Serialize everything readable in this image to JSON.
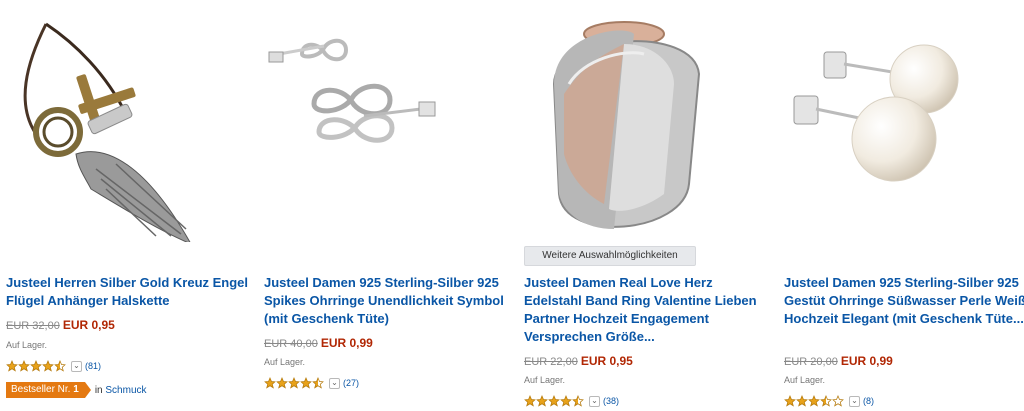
{
  "products": [
    {
      "title": "Justeel Herren Silber Gold Kreuz Engel Flügel Anhänger Halskette",
      "old_price": "EUR 32,00",
      "new_price": "EUR 0,95",
      "stock": "Auf Lager.",
      "rating_count": "(81)",
      "stars": 4.5,
      "image_icon": "angel-wing-necklace-image"
    },
    {
      "title": "Justeel Damen 925 Sterling-Silber 925 Spikes Ohrringe Unendlichkeit Symbol (mit Geschenk Tüte)",
      "old_price": "EUR 40,00",
      "new_price": "EUR 0,99",
      "stock": "Auf Lager.",
      "rating_count": "(27)",
      "stars": 4.5,
      "image_icon": "infinity-earrings-image"
    },
    {
      "title": "Justeel Damen Real Love Herz Edelstahl Band Ring Valentine Lieben Partner Hochzeit Engagement Versprechen Größe...",
      "old_price": "EUR 22,00",
      "new_price": "EUR 0,95",
      "stock": "Auf Lager.",
      "rating_count": "(38)",
      "stars": 4.5,
      "variants_label": "Weitere Auswahlmöglichkeiten",
      "image_icon": "heart-ring-image"
    },
    {
      "title": "Justeel Damen 925 Sterling-Silber 925 Gestüt Ohrringe Süßwasser Perle Weiß Hochzeit Elegant (mit Geschenk Tüte...",
      "old_price": "EUR 20,00",
      "new_price": "EUR 0,99",
      "stock": "Auf Lager.",
      "rating_count": "(8)",
      "stars": 3.5,
      "image_icon": "pearl-earrings-image"
    }
  ],
  "bestseller": {
    "label": "Bestseller Nr.",
    "rank": "1",
    "prefix": "in",
    "category": "Schmuck"
  },
  "colors": {
    "title_link": "#0a56a6",
    "price_red": "#b12704",
    "star_gold": "#e8a21a",
    "badge_orange": "#e47911"
  }
}
